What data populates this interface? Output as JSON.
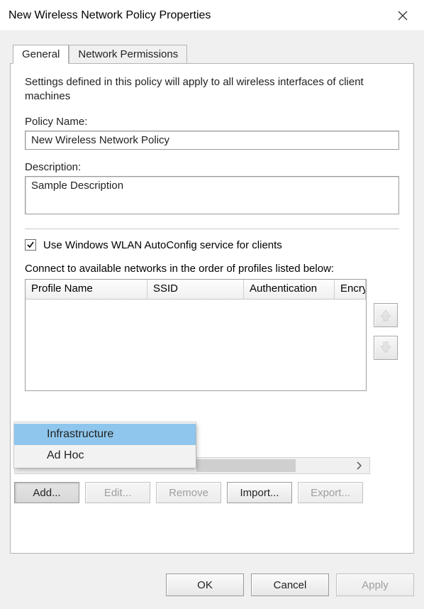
{
  "window": {
    "title": "New Wireless Network Policy Properties"
  },
  "tabs": [
    {
      "label": "General",
      "active": true
    },
    {
      "label": "Network Permissions",
      "active": false
    }
  ],
  "intro_text": "Settings defined in this policy will apply to all wireless interfaces of client machines",
  "policy_name": {
    "label": "Policy Name:",
    "value": "New Wireless Network Policy"
  },
  "description": {
    "label": "Description:",
    "value": "Sample Description"
  },
  "autoconfig": {
    "checked": true,
    "label": "Use Windows WLAN AutoConfig service for clients"
  },
  "connect_label": "Connect to available networks in the order of profiles listed below:",
  "profile_columns": [
    "Profile Name",
    "SSID",
    "Authentication",
    "Encryption"
  ],
  "profile_rows": [],
  "add_menu": {
    "items": [
      "Infrastructure",
      "Ad Hoc"
    ],
    "selected_index": 0
  },
  "actions": {
    "add": "Add...",
    "edit": "Edit...",
    "remove": "Remove",
    "import": "Import...",
    "export": "Export..."
  },
  "dialog_buttons": {
    "ok": "OK",
    "cancel": "Cancel",
    "apply": "Apply"
  }
}
